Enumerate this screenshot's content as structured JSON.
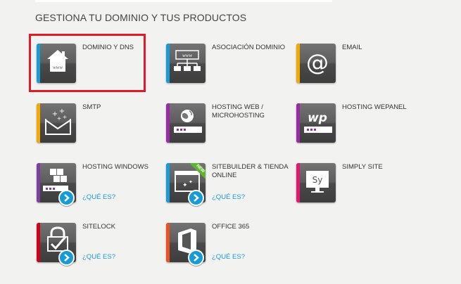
{
  "page": {
    "heading": "GESTIONA TU DOMINIO Y TUS PRODUCTOS"
  },
  "products": [
    {
      "label": "DOMINIO Y DNS",
      "icon": "house-www-icon",
      "stripe": "#1a9bd7",
      "selected": true
    },
    {
      "label": "ASOCIACIÓN DOMINIO",
      "icon": "www-hierarchy-icon",
      "stripe": "#1a9bd7"
    },
    {
      "label": "EMAIL",
      "icon": "at-sign-icon",
      "stripe": "#f5a800"
    },
    {
      "label": "SMTP",
      "icon": "envelope-sparkle-icon",
      "stripe": "#f5a800"
    },
    {
      "label": "HOSTING WEB / MICROHOSTING",
      "icon": "hosting-globe-icon",
      "stripe": "#9b2aa6"
    },
    {
      "label": "HOSTING WEPANEL",
      "icon": "wepanel-icon",
      "stripe": "#9b2aa6"
    },
    {
      "label": "HOSTING WINDOWS",
      "icon": "windows-hosting-icon",
      "stripe": "#7b3fa0",
      "info": "¿QUÉ ES?"
    },
    {
      "label": "SITEBUILDER & TIENDA ONLINE",
      "icon": "sitebuilder-icon",
      "stripe": "#1a9bd7",
      "info": "¿QUÉ ES?",
      "badge": "NEW"
    },
    {
      "label": "SIMPLY SITE",
      "icon": "simply-site-icon",
      "stripe": "#e6176f"
    },
    {
      "label": "SITELOCK",
      "icon": "sitelock-icon",
      "stripe": "#d0021b",
      "info": "¿QUÉ ES?"
    },
    {
      "label": "OFFICE 365",
      "icon": "office-icon",
      "stripe": "#e8531f",
      "info": "¿QUÉ ES?"
    }
  ],
  "colors": {
    "background": "#f2f2f1",
    "info_link": "#1a9bd7",
    "highlight": "#e01b24",
    "new_badge": "#5fb32e"
  }
}
